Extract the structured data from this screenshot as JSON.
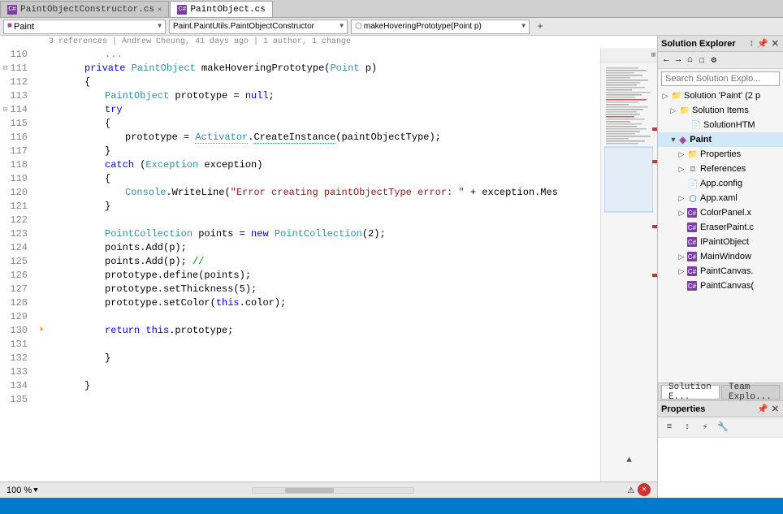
{
  "tabs": [
    {
      "label": "PaintObjectConstructor.cs",
      "active": false,
      "modified": false
    },
    {
      "label": "PaintObject.cs",
      "active": true,
      "modified": false
    }
  ],
  "toolbar": {
    "project_dropdown": "Paint",
    "class_dropdown": "Paint.PaintUtils.PaintObjectConstructor",
    "method_dropdown": "makeHoveringPrototype(Point p)",
    "plus_btn": "+"
  },
  "meta_info": "3 references | Andrew Cheung, 41 days ago | 1 author, 1 change",
  "code_lines": [
    {
      "num": 110,
      "indent": 3,
      "tokens": [
        {
          "t": "...",
          "c": "cmt"
        }
      ],
      "collapse": false
    },
    {
      "num": 111,
      "indent": 2,
      "collapse": true,
      "text": "private PaintObject makeHoveringPrototype(Point p)"
    },
    {
      "num": 112,
      "indent": 2,
      "text": "{"
    },
    {
      "num": 113,
      "indent": 3,
      "text": "PaintObject prototype = null;"
    },
    {
      "num": 114,
      "indent": 3,
      "collapse": true,
      "text": "try"
    },
    {
      "num": 115,
      "indent": 3,
      "text": "{"
    },
    {
      "num": 116,
      "indent": 4,
      "text": "prototype = Activator.CreateInstance(paintObjectType);",
      "underline": "CreateInstance"
    },
    {
      "num": 117,
      "indent": 3,
      "text": "}"
    },
    {
      "num": 118,
      "indent": 3,
      "text": "catch (Exception exception)"
    },
    {
      "num": 119,
      "indent": 3,
      "text": "{"
    },
    {
      "num": 120,
      "indent": 4,
      "text": "Console.WriteLine(\"Error creating paintObjectType error: \" + exception.Mes",
      "error": true
    },
    {
      "num": 121,
      "indent": 3,
      "text": "}"
    },
    {
      "num": 122,
      "indent": 0,
      "text": ""
    },
    {
      "num": 123,
      "indent": 3,
      "text": "PointCollection points = new PointCollection(2);"
    },
    {
      "num": 124,
      "indent": 3,
      "text": "points.Add(p);"
    },
    {
      "num": 125,
      "indent": 3,
      "text": "points.Add(p); //"
    },
    {
      "num": 126,
      "indent": 3,
      "text": "prototype.define(points);"
    },
    {
      "num": 127,
      "indent": 3,
      "text": "prototype.setThickness(5);"
    },
    {
      "num": 128,
      "indent": 3,
      "text": "prototype.setColor(this.color);"
    },
    {
      "num": 129,
      "indent": 0,
      "text": ""
    },
    {
      "num": 130,
      "indent": 3,
      "text": "return this.prototype;",
      "warn": true
    },
    {
      "num": 131,
      "indent": 0,
      "text": ""
    },
    {
      "num": 132,
      "indent": 3,
      "text": "}"
    },
    {
      "num": 133,
      "indent": 0,
      "text": ""
    },
    {
      "num": 134,
      "indent": 2,
      "text": "}"
    },
    {
      "num": 135,
      "indent": 0,
      "text": ""
    }
  ],
  "solution_explorer": {
    "title": "Solution Explorer",
    "search_placeholder": "Search Solution Explo...",
    "toolbar_icons": [
      "←",
      "→",
      "⌂",
      "☐",
      "⚙"
    ],
    "tree": [
      {
        "label": "Solution 'Paint' (2 p",
        "icon": "solution",
        "indent": 0,
        "expand": "▷"
      },
      {
        "label": "Solution Items",
        "icon": "folder",
        "indent": 1,
        "expand": "▷"
      },
      {
        "label": "SolutionHTM",
        "icon": "file",
        "indent": 2,
        "expand": ""
      },
      {
        "label": "Paint",
        "icon": "project",
        "indent": 1,
        "expand": "▼",
        "selected": true
      },
      {
        "label": "Properties",
        "icon": "folder",
        "indent": 2,
        "expand": "▷"
      },
      {
        "label": "References",
        "icon": "ref",
        "indent": 2,
        "expand": "▷"
      },
      {
        "label": "App.config",
        "icon": "config",
        "indent": 2,
        "expand": ""
      },
      {
        "label": "App.xaml",
        "icon": "xaml",
        "indent": 2,
        "expand": "▷"
      },
      {
        "label": "ColorPanel.x",
        "icon": "cs",
        "indent": 2,
        "expand": "▷"
      },
      {
        "label": "EraserPaint.c",
        "icon": "cs",
        "indent": 2,
        "expand": ""
      },
      {
        "label": "IPaintObject",
        "icon": "cs",
        "indent": 2,
        "expand": ""
      },
      {
        "label": "MainWindow",
        "icon": "cs",
        "indent": 2,
        "expand": "▷"
      },
      {
        "label": "PaintCanvas.",
        "icon": "cs",
        "indent": 2,
        "expand": "▷"
      },
      {
        "label": "PaintCanvas(",
        "icon": "cs",
        "indent": 2,
        "expand": ""
      }
    ]
  },
  "bottom_tabs": [
    {
      "label": "Solution E...",
      "active": true
    },
    {
      "label": "Team Explo...",
      "active": false
    }
  ],
  "properties": {
    "title": "Properties",
    "toolbar_icons": [
      "≡≡",
      "↕",
      "⚡"
    ]
  },
  "editor_bottom": {
    "zoom": "100 %"
  },
  "status_bar": {
    "items": []
  }
}
